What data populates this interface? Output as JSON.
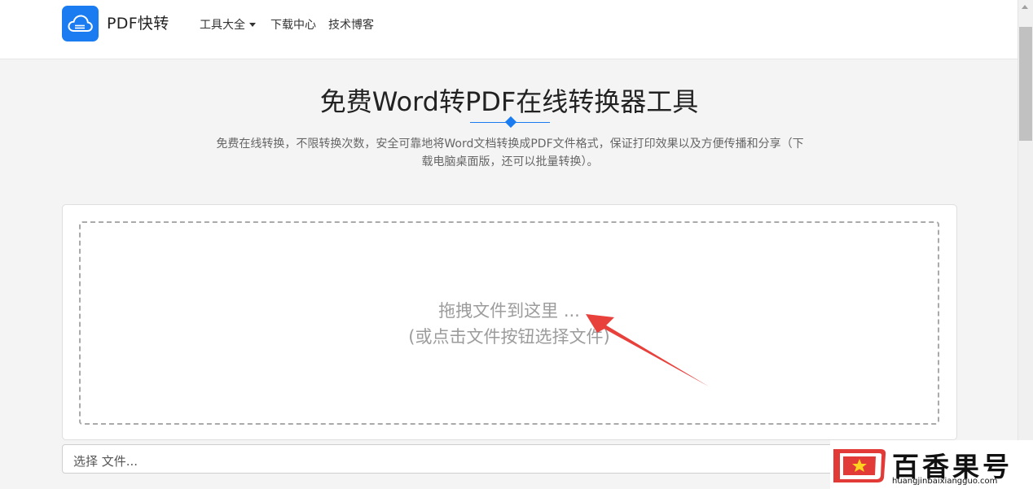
{
  "header": {
    "brand": "PDF快转",
    "nav": {
      "tools": "工具大全",
      "download": "下载中心",
      "blog": "技术博客"
    }
  },
  "hero": {
    "title": "免费Word转PDF在线转换器工具",
    "subtitle": "免费在线转换，不限转换次数，安全可靠地将Word文档转换成PDF文件格式，保证打印效果以及方便传播和分享（下载电脑桌面版，还可以批量转换）。"
  },
  "upload": {
    "drop_line1": "拖拽文件到这里 ...",
    "drop_line2": "(或点击文件按钮选择文件)",
    "file_placeholder": "选择 文件..."
  },
  "watermark": {
    "text": "百香果号",
    "url": "huangjinbaixiangguo.com"
  },
  "colors": {
    "accent": "#1a7cf0",
    "arrow": "#e8413c"
  },
  "icons": {
    "logo": "cloud-icon",
    "dropdown": "caret-down-icon",
    "annotation": "red-arrow-icon"
  }
}
